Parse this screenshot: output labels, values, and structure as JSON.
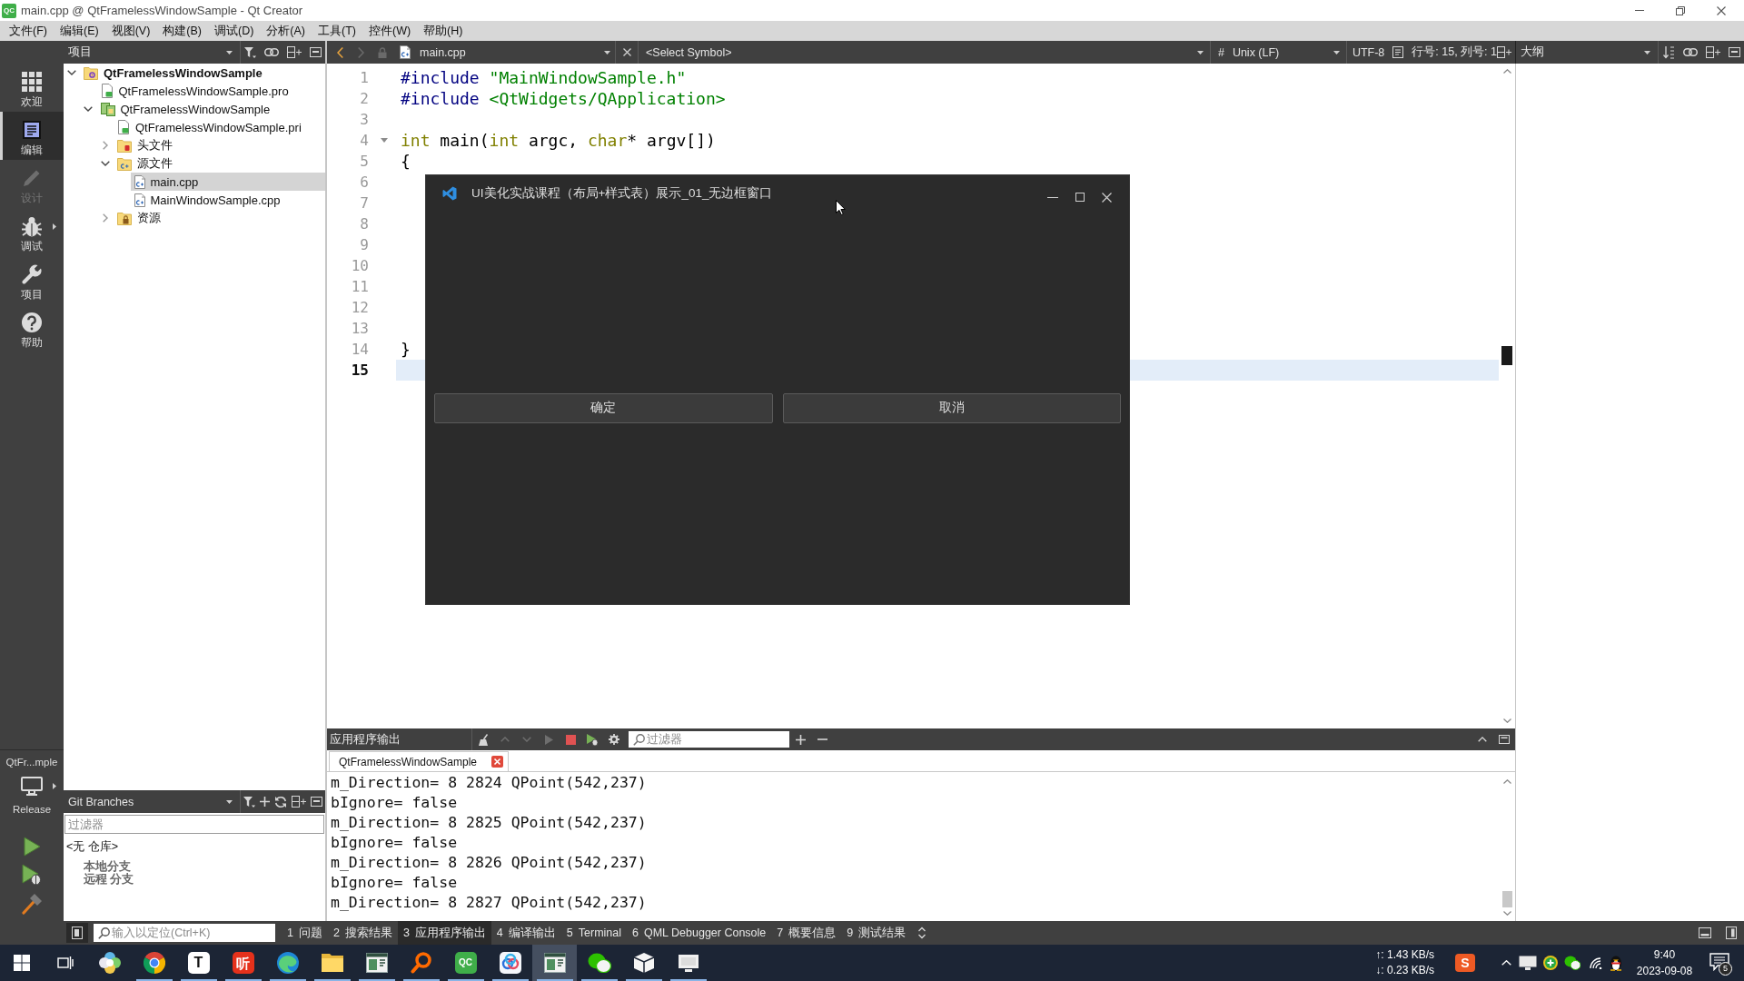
{
  "window": {
    "logo": "QC",
    "title": "main.cpp @ QtFramelessWindowSample - Qt Creator"
  },
  "menu": [
    "文件(F)",
    "编辑(E)",
    "视图(V)",
    "构建(B)",
    "调试(D)",
    "分析(A)",
    "工具(T)",
    "控件(W)",
    "帮助(H)"
  ],
  "mode_bar": {
    "modes": [
      {
        "kind": "welcome",
        "label": "欢迎",
        "selected": false,
        "disabled": false
      },
      {
        "kind": "edit",
        "label": "编辑",
        "selected": true,
        "disabled": false
      },
      {
        "kind": "design",
        "label": "设计",
        "selected": false,
        "disabled": true
      },
      {
        "kind": "debug",
        "label": "调试",
        "selected": false,
        "disabled": false
      },
      {
        "kind": "projects",
        "label": "项目",
        "selected": false,
        "disabled": false
      },
      {
        "kind": "help",
        "label": "帮助",
        "selected": false,
        "disabled": false
      }
    ],
    "kit": {
      "project": "QtFr...mple",
      "build": "Release"
    }
  },
  "project_pane": {
    "view": "项目",
    "tree": [
      {
        "kind": "project",
        "label": "QtFramelessWindowSample",
        "selected": false,
        "expanded": true,
        "children": [
          {
            "kind": "profile",
            "label": "QtFramelessWindowSample.pro",
            "selected": false
          },
          {
            "kind": "subproject",
            "label": "QtFramelessWindowSample",
            "selected": false,
            "expanded": true,
            "children": [
              {
                "kind": "profile",
                "label": "QtFramelessWindowSample.pri",
                "selected": false
              },
              {
                "kind": "headers",
                "label": "头文件",
                "selected": false,
                "expanded": false
              },
              {
                "kind": "sources",
                "label": "源文件",
                "selected": false,
                "expanded": true,
                "children": [
                  {
                    "kind": "source",
                    "label": "main.cpp",
                    "selected": true
                  },
                  {
                    "kind": "source",
                    "label": "MainWindowSample.cpp",
                    "selected": false
                  }
                ]
              },
              {
                "kind": "resources",
                "label": "资源",
                "selected": false,
                "expanded": false
              }
            ]
          }
        ]
      }
    ]
  },
  "git_pane": {
    "view": "Git Branches",
    "filter_placeholder": "过滤器",
    "tree": [
      {
        "label": "<无 仓库>",
        "children": [
          {
            "label": "本地分支"
          },
          {
            "label": "远程 分支"
          }
        ]
      }
    ]
  },
  "editor": {
    "file": "main.cpp",
    "symbol": "<Select Symbol>",
    "hash_button": "#",
    "line_ending": "Unix (LF)",
    "encoding": "UTF-8",
    "position": "行号: 15, 列号: 1",
    "lines": [
      {
        "number": "1",
        "current": false,
        "fold": false,
        "tokens": [
          {
            "kind": "preprocessor",
            "text": "#include "
          },
          {
            "kind": "string",
            "text": "\"MainWindowSample.h\""
          }
        ]
      },
      {
        "number": "2",
        "current": false,
        "fold": false,
        "tokens": [
          {
            "kind": "preprocessor",
            "text": "#include "
          },
          {
            "kind": "string",
            "text": "<QtWidgets/QApplication>"
          }
        ]
      },
      {
        "number": "3",
        "current": false,
        "fold": false
      },
      {
        "number": "4",
        "current": false,
        "fold": true,
        "tokens": [
          {
            "kind": "keyword",
            "text": "int"
          },
          {
            "kind": "plain",
            "text": " main("
          },
          {
            "kind": "keyword",
            "text": "int"
          },
          {
            "kind": "plain",
            "text": " argc, "
          },
          {
            "kind": "keyword",
            "text": "char"
          },
          {
            "kind": "plain",
            "text": "* argv[])"
          }
        ]
      },
      {
        "number": "5",
        "current": false,
        "fold": false,
        "tokens": [
          {
            "kind": "plain",
            "text": "{"
          }
        ]
      },
      {
        "number": "6",
        "current": false,
        "fold": false
      },
      {
        "number": "7",
        "current": false,
        "fold": false
      },
      {
        "number": "8",
        "current": false,
        "fold": false
      },
      {
        "number": "9",
        "current": false,
        "fold": false
      },
      {
        "number": "10",
        "current": false,
        "fold": false
      },
      {
        "number": "11",
        "current": false,
        "fold": false
      },
      {
        "number": "12",
        "current": false,
        "fold": false
      },
      {
        "number": "13",
        "current": false,
        "fold": false
      },
      {
        "number": "14",
        "current": false,
        "fold": false,
        "tokens": [
          {
            "kind": "plain",
            "text": "}"
          }
        ]
      },
      {
        "number": "15",
        "current": true,
        "fold": false
      }
    ]
  },
  "outline_pane": {
    "view": "大纲"
  },
  "dialog": {
    "title": "UI美化实战课程（布局+样式表）展示_01_无边框窗口",
    "buttons": [
      "确定",
      "取消"
    ]
  },
  "output": {
    "title": "应用程序输出",
    "filter_placeholder": "过滤器",
    "tabs": [
      {
        "label": "QtFramelessWindowSample",
        "selected": true
      }
    ],
    "lines": [
      "m_Direction= 8 2824 QPoint(542,237)",
      "bIgnore= false",
      "m_Direction= 8 2825 QPoint(542,237)",
      "bIgnore= false",
      "m_Direction= 8 2826 QPoint(542,237)",
      "bIgnore= false",
      "m_Direction= 8 2827 QPoint(542,237)"
    ]
  },
  "status_bar": {
    "locator_placeholder": "输入以定位(Ctrl+K)",
    "panes": [
      {
        "number": "1",
        "label": "问题",
        "selected": false
      },
      {
        "number": "2",
        "label": "搜索结果",
        "selected": false
      },
      {
        "number": "3",
        "label": "应用程序输出",
        "selected": true
      },
      {
        "number": "4",
        "label": "编译输出",
        "selected": false
      },
      {
        "number": "5",
        "label": "Terminal",
        "selected": false
      },
      {
        "number": "6",
        "label": "QML Debugger Console",
        "selected": false
      },
      {
        "number": "7",
        "label": "概要信息",
        "selected": false
      },
      {
        "number": "9",
        "label": "测试结果",
        "selected": false
      }
    ]
  },
  "taskbar": {
    "apps": [
      {
        "kind": "pinwheel",
        "running": false,
        "active": false
      },
      {
        "kind": "globe",
        "running": true,
        "active": false
      },
      {
        "kind": "lighttile",
        "glyph": "T",
        "running": true,
        "active": false
      },
      {
        "kind": "redtile",
        "glyph": "听",
        "running": true,
        "active": false
      },
      {
        "kind": "wave",
        "running": true,
        "active": false
      },
      {
        "kind": "folder",
        "running": true,
        "active": false
      },
      {
        "kind": "notebook",
        "running": true,
        "active": false
      },
      {
        "kind": "magnifier",
        "running": true,
        "active": false
      },
      {
        "kind": "greentile",
        "glyph": "QC",
        "running": true,
        "active": false
      },
      {
        "kind": "rings",
        "running": true,
        "active": false
      },
      {
        "kind": "notebook",
        "running": true,
        "active": true
      },
      {
        "kind": "chat",
        "running": true,
        "active": false
      },
      {
        "kind": "box",
        "running": true,
        "active": false
      },
      {
        "kind": "monitor",
        "running": true,
        "active": false
      }
    ],
    "upload": "↑: 1.43 KB/s",
    "download": "↓: 0.23 KB/s",
    "ime": "S",
    "time": "9:40",
    "date": "2023-09-08",
    "notifications": "5"
  }
}
